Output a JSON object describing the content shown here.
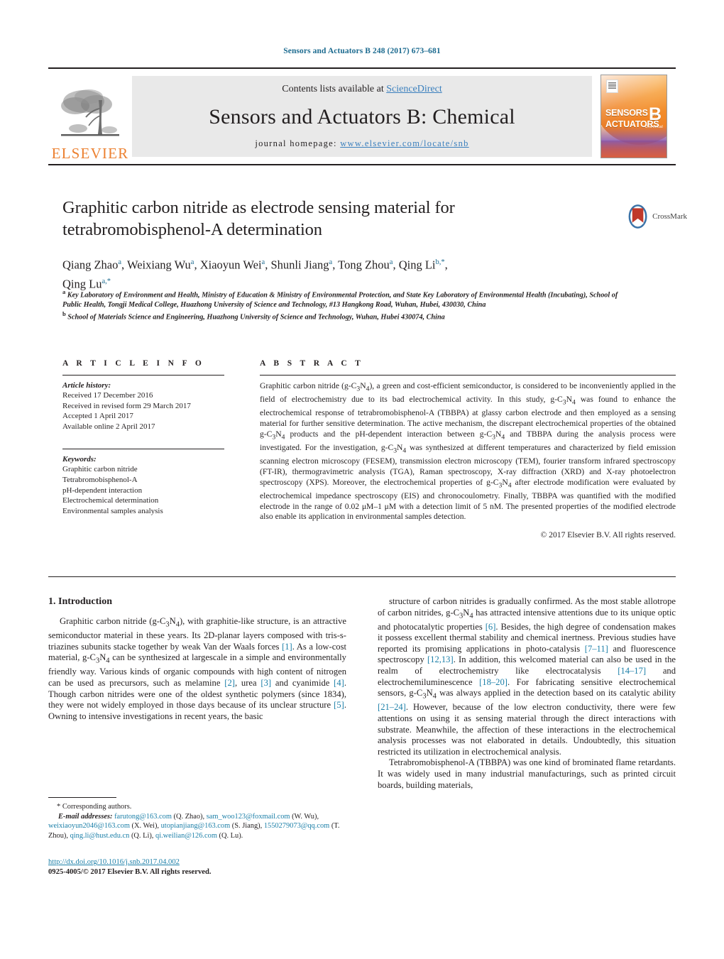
{
  "running_head": "Sensors and Actuators B 248 (2017) 673–681",
  "masthead": {
    "publisher_logo_word": "ELSEVIER",
    "contents_prefix": "Contents lists available at ",
    "contents_link": "ScienceDirect",
    "journal_title": "Sensors and Actuators B: Chemical",
    "homepage_prefix": "journal homepage: ",
    "homepage_url": "www.elsevier.com/locate/snb",
    "cover": {
      "line1": "SENSORS",
      "line1_small": "and",
      "line2": "ACTUATORS",
      "letter": "B",
      "sub": "Chemical"
    }
  },
  "article": {
    "title": "Graphitic carbon nitride as electrode sensing material for tetrabromobisphenol-A determination",
    "crossmark_label": "CrossMark",
    "authors_html": "Qiang Zhao<sup>a</sup>, Weixiang Wu<sup>a</sup>, Xiaoyun Wei<sup>a</sup>, Shunli Jiang<sup>a</sup>, Tong Zhou<sup>a</sup>, Qing Li<sup>b,</sup><sup>*</sup>,<br>Qing Lu<sup>a,</sup><sup>*</sup>",
    "affiliation_a": "Key Laboratory of Environment and Health, Ministry of Education & Ministry of Environmental Protection, and State Key Laboratory of Environmental Health (Incubating), School of Public Health, Tongji Medical College, Huazhong University of Science and Technology, #13 Hangkong Road, Wuhan, Hubei, 430030, China",
    "affiliation_b": "School of Materials Science and Engineering, Huazhong University of Science and Technology, Wuhan, Hubei 430074, China",
    "affiliation_a_marker": "a",
    "affiliation_b_marker": "b"
  },
  "article_info": {
    "heading": "A R T I C L E   I N F O",
    "history_label": "Article history:",
    "history": [
      "Received 17 December 2016",
      "Received in revised form 29 March 2017",
      "Accepted 1 April 2017",
      "Available online 2 April 2017"
    ],
    "keywords_label": "Keywords:",
    "keywords": [
      "Graphitic carbon nitride",
      "Tetrabromobisphenol-A",
      "pH-dependent interaction",
      "Electrochemical determination",
      "Environmental samples analysis"
    ]
  },
  "abstract": {
    "heading": "A B S T R A C T",
    "body_html": "Graphitic carbon nitride (g-C<sub>3</sub>N<sub>4</sub>), a green and cost-efficient semiconductor, is considered to be inconveniently applied in the field of electrochemistry due to its bad electrochemical activity. In this study, g-C<sub>3</sub>N<sub>4</sub> was found to enhance the electrochemical response of tetrabromobisphenol-A (TBBPA) at glassy carbon electrode and then employed as a sensing material for further sensitive determination. The active mechanism, the discrepant electrochemical properties of the obtained g-C<sub>3</sub>N<sub>4</sub> products and the pH-dependent interaction between g-C<sub>3</sub>N<sub>4</sub> and TBBPA during the analysis process were investigated. For the investigation, g-C<sub>3</sub>N<sub>4</sub> was synthesized at different temperatures and characterized by field emission scanning electron microscopy (FESEM), transmission electron microscopy (TEM), fourier transform infrared spectroscopy (FT-IR), thermogravimetric analysis (TGA), Raman spectroscopy, X-ray diffraction (XRD) and X-ray photoelectron spectroscopy (XPS). Moreover, the electrochemical properties of g-C<sub>3</sub>N<sub>4</sub> after electrode modification were evaluated by electrochemical impedance spectroscopy (EIS) and chronocoulometry. Finally, TBBPA was quantified with the modified electrode in the range of 0.02 &mu;M&ndash;1 &mu;M with a detection limit of 5 nM. The presented properties of the modified electrode also enable its application in environmental samples detection.",
    "copyright": "© 2017 Elsevier B.V. All rights reserved."
  },
  "body": {
    "section_heading": "1.  Introduction",
    "left_paragraphs_html": [
      "Graphitic carbon nitride (g-C<sub>3</sub>N<sub>4</sub>), with graphitie-like structure, is an attractive semiconductor material in these years. Its 2D-planar layers composed with tris-s-triazines subunits stacke together by weak Van der Waals forces <span class=\"ref\">[1]</span>. As a low-cost material, g-C<sub>3</sub>N<sub>4</sub> can be synthesized at largescale in a simple and environmentally friendly way. Various kinds of organic compounds with high content of nitrogen can be used as precursors, such as melamine <span class=\"ref\">[2]</span>, urea <span class=\"ref\">[3]</span> and cyanimide <span class=\"ref\">[4]</span>. Though carbon nitrides were one of the oldest synthetic polymers (since 1834), they were not widely employed in those days because of its unclear structure <span class=\"ref\">[5]</span>. Owning to intensive investigations in recent years, the basic"
    ],
    "right_paragraphs_html": [
      "structure of carbon nitrides is gradually confirmed. As the most stable allotrope of carbon nitrides, g-C<sub>3</sub>N<sub>4</sub> has attracted intensive attentions due to its unique optic and photocatalytic properties <span class=\"ref\">[6]</span>. Besides, the high degree of condensation makes it possess excellent thermal stability and chemical inertness. Previous studies have reported its promising applications in photo-catalysis <span class=\"ref\">[7&ndash;11]</span> and fluorescence spectroscopy <span class=\"ref\">[12,13]</span>. In addition, this welcomed material can also be used in the realm of electrochemistry like electrocatalysis <span class=\"ref\">[14&ndash;17]</span> and electrochemiluminescence <span class=\"ref\">[18&ndash;20]</span>. For fabricating sensitive electrochemical sensors, g-C<sub>3</sub>N<sub>4</sub> was always applied in the detection based on its catalytic ability <span class=\"ref\">[21&ndash;24]</span>. However, because of the low electron conductivity, there were few attentions on using it as sensing material through the direct interactions with substrate. Meanwhile, the affection of these interactions in the electrochemical analysis processes was not elaborated in details. Undoubtedly, this situation restricted its utilization in electrochemical analysis.",
      "Tetrabromobisphenol-A (TBBPA) was one kind of brominated flame retardants. It was widely used in many industrial manufacturings, such as printed circuit boards, building materials,"
    ]
  },
  "footnotes": {
    "corresponding": "Corresponding authors.",
    "corresponding_marker": "*",
    "email_label": "E-mail addresses:",
    "emails_html": "<span class=\"mail\">farutong@163.com</span> (Q. Zhao), <span class=\"mail\">sam_woo123@foxmail.com</span> (W. Wu), <span class=\"mail\">weixiaoyun2046@163.com</span> (X. Wei), <span class=\"mail\">utopianjiang@163.com</span> (S. Jiang), <span class=\"mail\">1550279073@qq.com</span> (T. Zhou), <span class=\"mail\">qing.li@hust.edu.cn</span> (Q. Li), <span class=\"mail\">qi.weilian@126.com</span> (Q. Lu).",
    "doi": "http://dx.doi.org/10.1016/j.snb.2017.04.002",
    "issn_line": "0925-4005/© 2017 Elsevier B.V. All rights reserved."
  },
  "colors": {
    "link_blue": "#1b7fa8",
    "header_blue": "#1b6a8f",
    "elsevier_orange": "#ec8131",
    "masthead_grey": "#e9e9e9",
    "text": "#231f20"
  }
}
